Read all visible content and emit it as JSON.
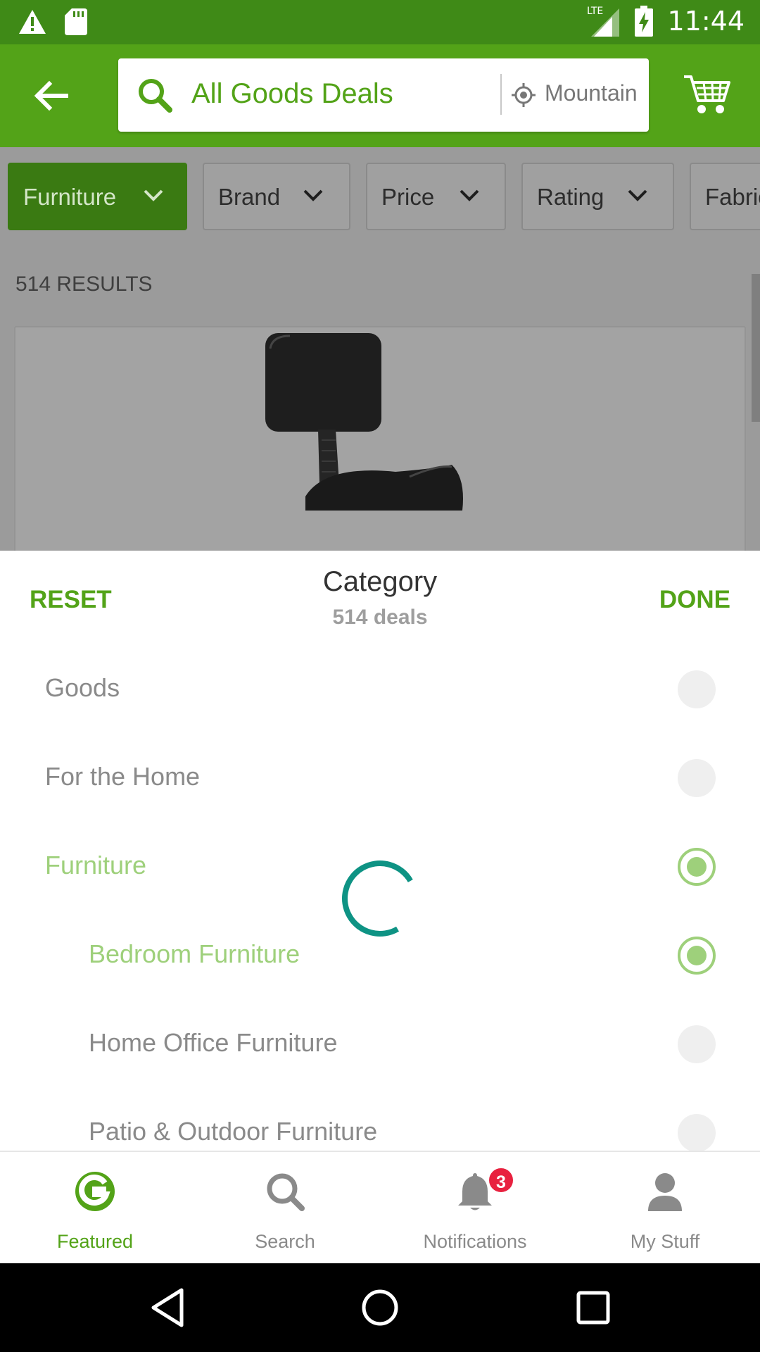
{
  "status_bar": {
    "time": "11:44",
    "network": "LTE",
    "icons": [
      "warning-icon",
      "sd-card-icon",
      "signal-icon",
      "battery-charging-icon"
    ]
  },
  "app_bar": {
    "search_text": "All Goods Deals",
    "location_text": "Mountain View",
    "colors": {
      "primary": "#53a318",
      "status": "#3f8a17"
    }
  },
  "filters": [
    {
      "label": "Furniture",
      "active": true
    },
    {
      "label": "Brand",
      "active": false
    },
    {
      "label": "Price",
      "active": false
    },
    {
      "label": "Rating",
      "active": false
    },
    {
      "label": "Fabric",
      "active": false
    }
  ],
  "results": {
    "count_text": "514 RESULTS"
  },
  "sheet": {
    "reset_label": "RESET",
    "done_label": "DONE",
    "title": "Category",
    "subtitle": "514 deals",
    "options": [
      {
        "label": "Goods",
        "selected": false
      },
      {
        "label": "For the Home",
        "selected": false
      },
      {
        "label": "Furniture",
        "selected": true
      },
      {
        "label": "Bedroom Furniture",
        "selected": true
      },
      {
        "label": "Home Office Furniture",
        "selected": false
      },
      {
        "label": "Patio & Outdoor Furniture",
        "selected": false
      }
    ]
  },
  "bottom_nav": {
    "tabs": [
      {
        "label": "Featured",
        "icon": "groupon-g-icon",
        "active": true
      },
      {
        "label": "Search",
        "icon": "search-icon",
        "active": false
      },
      {
        "label": "Notifications",
        "icon": "bell-icon",
        "active": false,
        "badge": "3"
      },
      {
        "label": "My Stuff",
        "icon": "person-icon",
        "active": false
      }
    ]
  }
}
